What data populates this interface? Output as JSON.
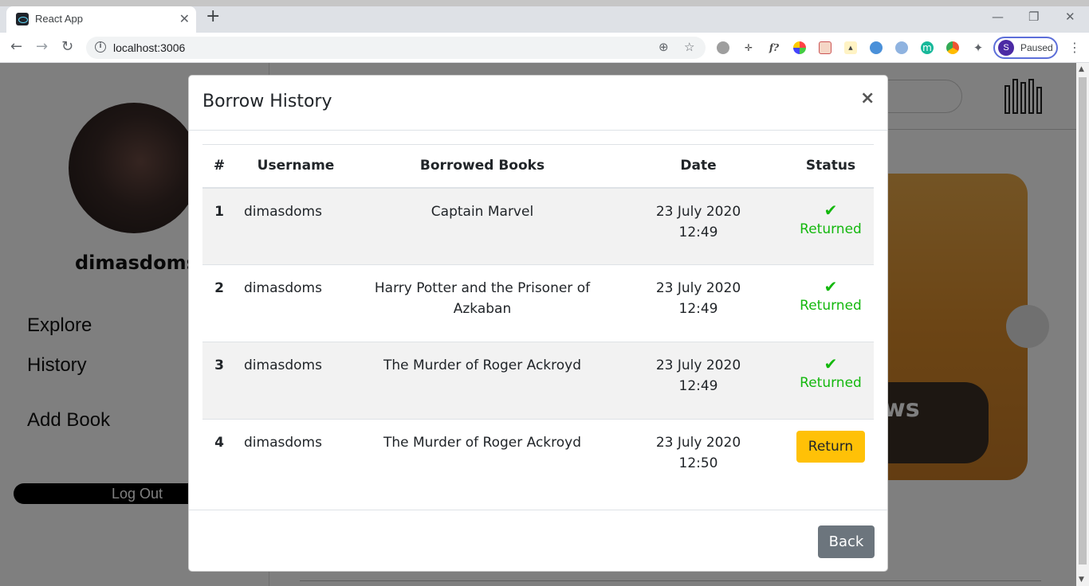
{
  "browser": {
    "tab_title": "React App",
    "tab_close": "✕",
    "new_tab": "+",
    "url": "localhost:3006",
    "profile_initial": "S",
    "profile_status": "Paused",
    "win_minimize": "—",
    "win_restore": "❐",
    "win_close": "✕"
  },
  "page": {
    "username": "dimasdoms",
    "nav": {
      "explore": "Explore",
      "history": "History",
      "add_book": "Add Book"
    },
    "logout_label": "Log Out",
    "banner_text": "ws"
  },
  "modal": {
    "title": "Borrow History",
    "close_label": "×",
    "columns": [
      "#",
      "Username",
      "Borrowed Books",
      "Date",
      "Status"
    ],
    "rows": [
      {
        "num": "1",
        "username": "dimasdoms",
        "book": "Captain Marvel",
        "date": "23 July 2020",
        "time": "12:49",
        "status": "Returned"
      },
      {
        "num": "2",
        "username": "dimasdoms",
        "book": "Harry Potter and the Prisoner of Azkaban",
        "date": "23 July 2020",
        "time": "12:49",
        "status": "Returned"
      },
      {
        "num": "3",
        "username": "dimasdoms",
        "book": "The Murder of Roger Ackroyd",
        "date": "23 July 2020",
        "time": "12:49",
        "status": "Returned"
      },
      {
        "num": "4",
        "username": "dimasdoms",
        "book": "The Murder of Roger Ackroyd",
        "date": "23 July 2020",
        "time": "12:50",
        "status": "Return"
      }
    ],
    "back_label": "Back"
  },
  "colors": {
    "returned_green": "#14b80e",
    "return_button_yellow": "#ffc107",
    "back_button_gray": "#6c757d"
  }
}
